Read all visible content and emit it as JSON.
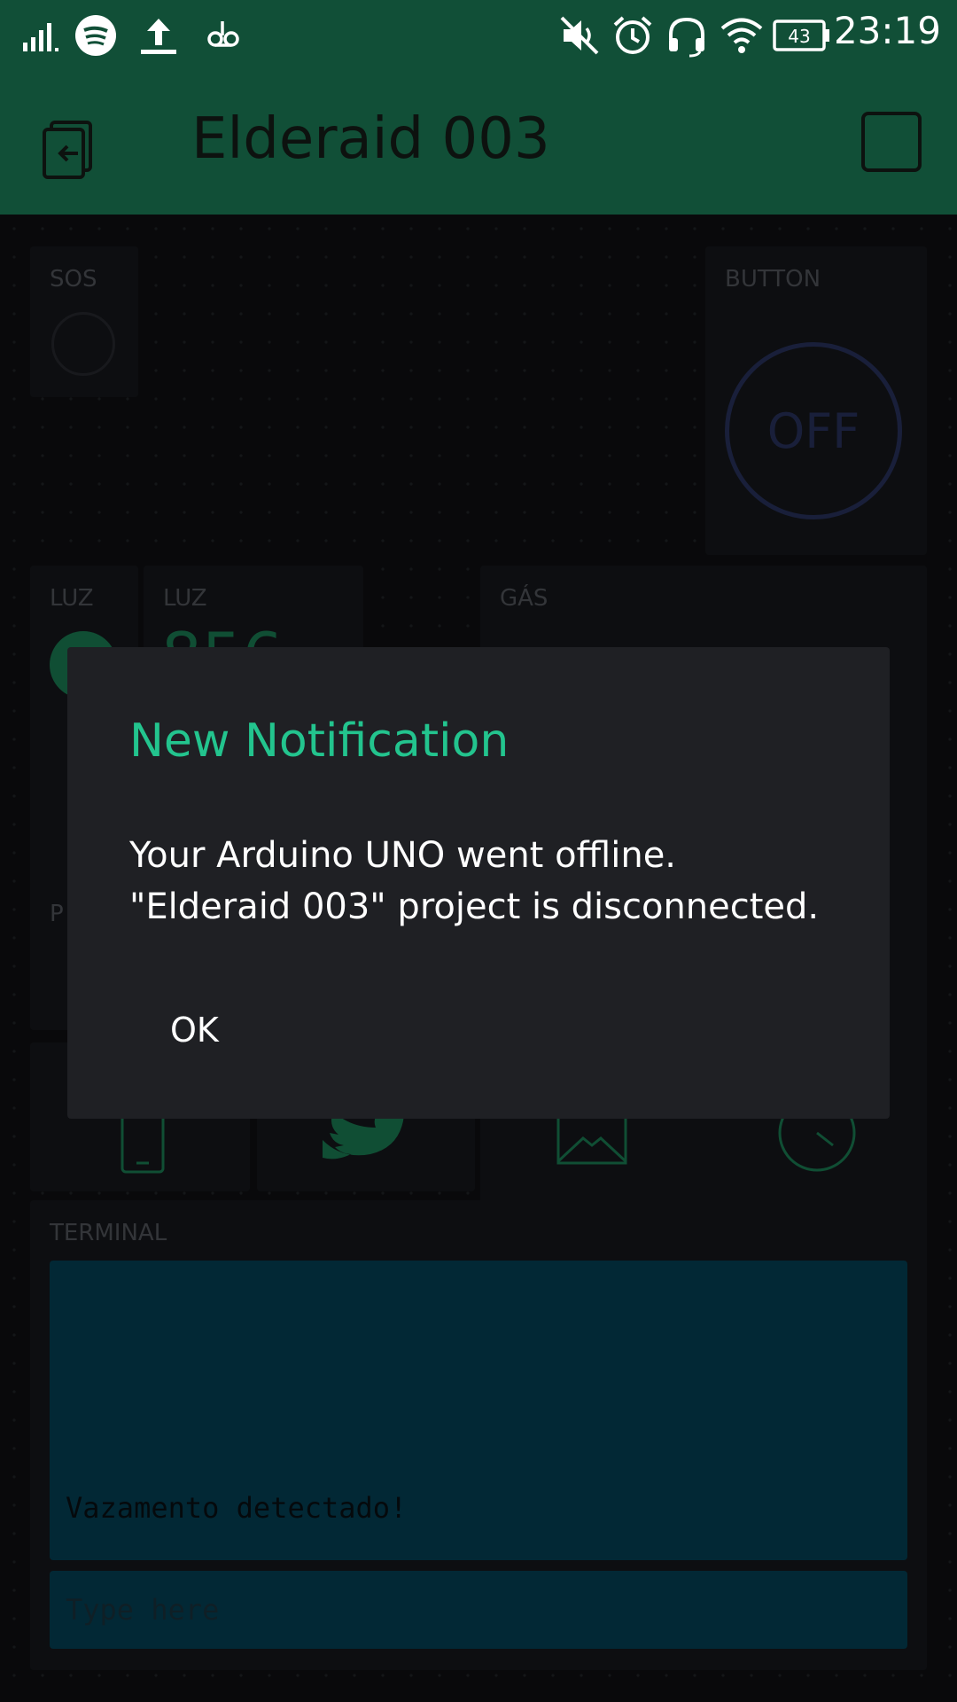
{
  "status_bar": {
    "time": "23:19",
    "battery": "43",
    "icons": [
      "signal-icon",
      "spotify-icon",
      "upload-icon",
      "voicemail-icon",
      "mute-icon",
      "alarm-icon",
      "headset-icon",
      "wifi-icon",
      "battery-icon"
    ]
  },
  "app_bar": {
    "title": "Elderaid 003"
  },
  "widgets": {
    "sos_label": "SOS",
    "button_label": "BUTTON",
    "button_state": "OFF",
    "luz_led_label": "LUZ",
    "luz_value_label": "LUZ",
    "luz_value": "856",
    "gas_label": "GÁS",
    "partial_label": "P"
  },
  "terminal": {
    "label": "TERMINAL",
    "output": "Vazamento detectado!",
    "input_placeholder": "Type here"
  },
  "dialog": {
    "title": "New Notification",
    "message": "Your Arduino UNO went offline. \"Elderaid 003\" project is disconnected.",
    "ok_label": "OK"
  },
  "colors": {
    "app_green": "#114f37",
    "accent_green": "#23c48e",
    "button_blue": "#2e3a6a",
    "terminal_blue": "#044a62"
  }
}
